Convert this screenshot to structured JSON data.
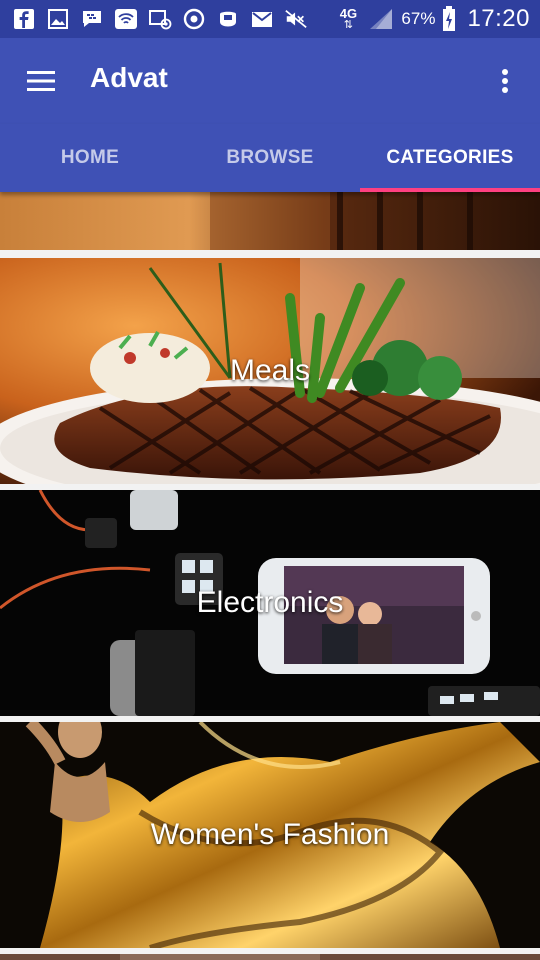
{
  "status_bar": {
    "icons": [
      "facebook-icon",
      "gallery-icon",
      "bbm-icon",
      "wifi-icon",
      "image-at-icon",
      "sync-icon",
      "ucoin-icon",
      "gmail-icon",
      "mute-icon",
      "network-4g-icon",
      "signal-icon"
    ],
    "network": "4G",
    "battery_percent": "67%",
    "time": "17:20"
  },
  "app_bar": {
    "title": "Advat",
    "menu_icon": "hamburger-menu-icon",
    "overflow_icon": "more-vert-icon"
  },
  "tabs": [
    {
      "label": "HOME",
      "active": false
    },
    {
      "label": "BROWSE",
      "active": false
    },
    {
      "label": "CATEGORIES",
      "active": true
    }
  ],
  "accent_color": "#ff4081",
  "primary_color": "#3f51b5",
  "categories": [
    {
      "label": ""
    },
    {
      "label": "Meals"
    },
    {
      "label": "Electronics"
    },
    {
      "label": "Women's Fashion"
    },
    {
      "label": ""
    }
  ]
}
